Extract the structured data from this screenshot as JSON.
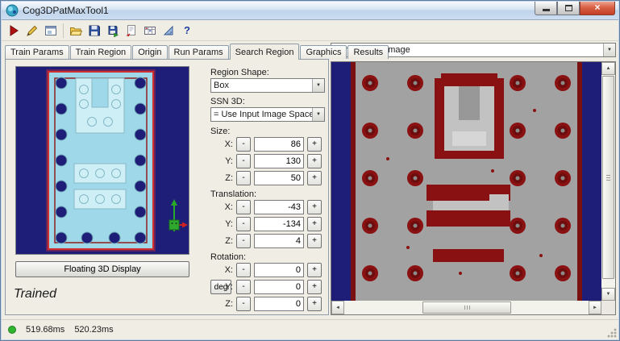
{
  "window": {
    "title": "Cog3DPatMaxTool1",
    "close_glyph": "×"
  },
  "toolbar": {
    "icons": [
      "run-icon",
      "edit-pencil-icon",
      "record-window-icon",
      "open-folder-icon",
      "save-icon",
      "save-as-icon",
      "import-image-icon",
      "results-grid-icon",
      "measure-icon",
      "help-icon"
    ],
    "help_glyph": "?"
  },
  "icons": {
    "dropdown_arrow": "▼",
    "scroll_up": "▲",
    "scroll_down": "▼",
    "scroll_left": "◄",
    "scroll_right": "►"
  },
  "tabs": {
    "items": [
      {
        "label": "Train Params",
        "active": false
      },
      {
        "label": "Train Region",
        "active": false
      },
      {
        "label": "Origin",
        "active": false
      },
      {
        "label": "Run Params",
        "active": false
      },
      {
        "label": "Search Region",
        "active": true
      },
      {
        "label": "Graphics",
        "active": false
      },
      {
        "label": "Results",
        "active": false
      }
    ]
  },
  "left_panel": {
    "floating_button_label": "Floating 3D Display",
    "trained_text": "Trained"
  },
  "form": {
    "region_shape_label": "Region Shape:",
    "region_shape_value": "Box",
    "ssn3d_label": "SSN 3D:",
    "ssn3d_value": "= Use Input Image Space",
    "minus_label": "-",
    "plus_label": "+",
    "size": {
      "label": "Size:",
      "rows": [
        {
          "axis": "X:",
          "value": "86"
        },
        {
          "axis": "Y:",
          "value": "130"
        },
        {
          "axis": "Z:",
          "value": "50"
        }
      ]
    },
    "translation": {
      "label": "Translation:",
      "rows": [
        {
          "axis": "X:",
          "value": "-43"
        },
        {
          "axis": "Y:",
          "value": "-134"
        },
        {
          "axis": "Z:",
          "value": "4"
        }
      ]
    },
    "rotation": {
      "label": "Rotation:",
      "deg_button_label": "deg",
      "rows": [
        {
          "axis": "X:",
          "value": "0"
        },
        {
          "axis": "Y:",
          "value": "0"
        },
        {
          "axis": "Z:",
          "value": "0"
        }
      ]
    }
  },
  "right_panel": {
    "image_selector_value": "Current.InputImage"
  },
  "status_bar": {
    "run_time": "519.68ms",
    "total_time": "520.23ms",
    "status_color": "#2FB52F"
  },
  "colors": {
    "view3d_background": "#1E1E78",
    "part_fill": "#9FD8E8",
    "region_outline": "#D03030",
    "image_dark_red": "#8A1111",
    "image_gray": "#A2A2A2",
    "image_navy": "#1E1E78"
  }
}
